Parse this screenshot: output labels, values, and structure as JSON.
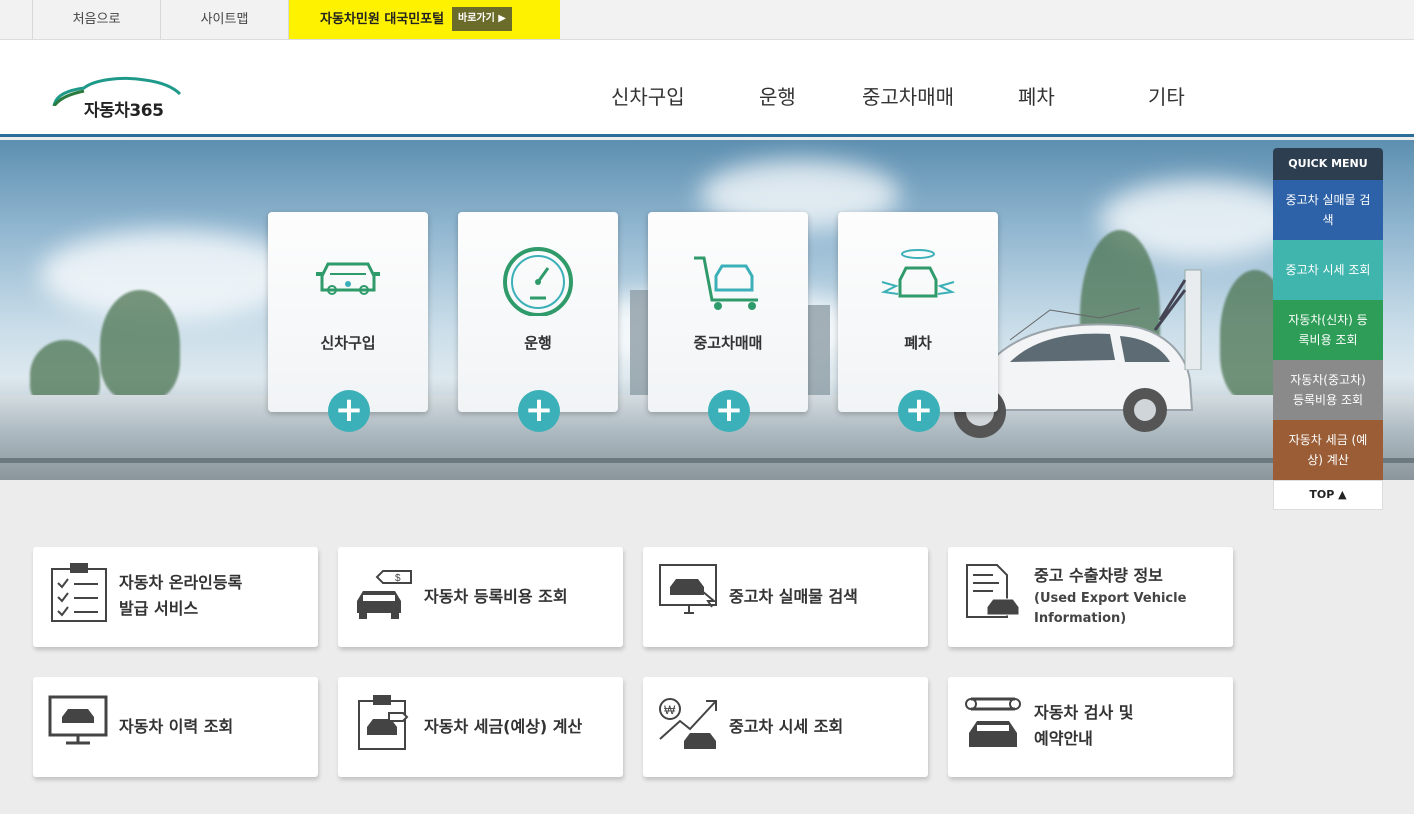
{
  "topbar": {
    "home": "처음으로",
    "sitemap": "사이트맵",
    "portal_label": "자동차민원 대국민포털",
    "portal_button": "바로가기 ▶"
  },
  "header": {
    "logo_text": "자동차365",
    "nav": [
      "신차구입",
      "운행",
      "중고차매매",
      "폐차",
      "기타"
    ]
  },
  "banner": {
    "cards": [
      {
        "label": "신차구입",
        "icon": "new-car-icon"
      },
      {
        "label": "운행",
        "icon": "speedometer-icon"
      },
      {
        "label": "중고차매매",
        "icon": "cart-car-icon"
      },
      {
        "label": "폐차",
        "icon": "angel-car-icon"
      }
    ],
    "plus": "+"
  },
  "quick_menu": {
    "title": "QUICK MENU",
    "items": [
      {
        "label": "중고차 실매물 검색",
        "color": "#2d62a8"
      },
      {
        "label": "중고차 시세 조회",
        "color": "#3fb5ad"
      },
      {
        "label": "자동차(신차) 등록비용 조회",
        "color": "#2e9d58"
      },
      {
        "label": "자동차(중고차) 등록비용 조회",
        "color": "#8a8a8a"
      },
      {
        "label": "자동차 세금 (예상) 계산",
        "color": "#9a5d36"
      }
    ],
    "top": "TOP ▲"
  },
  "services": [
    {
      "line1": "자동차 온라인등록",
      "line2": "발급 서비스",
      "icon": "clipboard-checklist-icon"
    },
    {
      "line1": "자동차 등록비용 조회",
      "icon": "car-price-tag-icon"
    },
    {
      "line1": "중고차 실매물 검색",
      "icon": "monitor-car-search-icon"
    },
    {
      "line1": "중고 수출차량 정보",
      "sub": "(Used Export Vehicle Information)",
      "icon": "document-car-icon"
    },
    {
      "line1": "자동차 이력 조회",
      "icon": "monitor-car-icon"
    },
    {
      "line1": "자동차 세금(예상) 계산",
      "icon": "clipboard-car-tag-icon"
    },
    {
      "line1": "중고차 시세 조회",
      "icon": "won-trend-car-icon"
    },
    {
      "line1": "자동차 검사 및",
      "line2": "예약안내",
      "icon": "wrench-car-icon"
    }
  ]
}
